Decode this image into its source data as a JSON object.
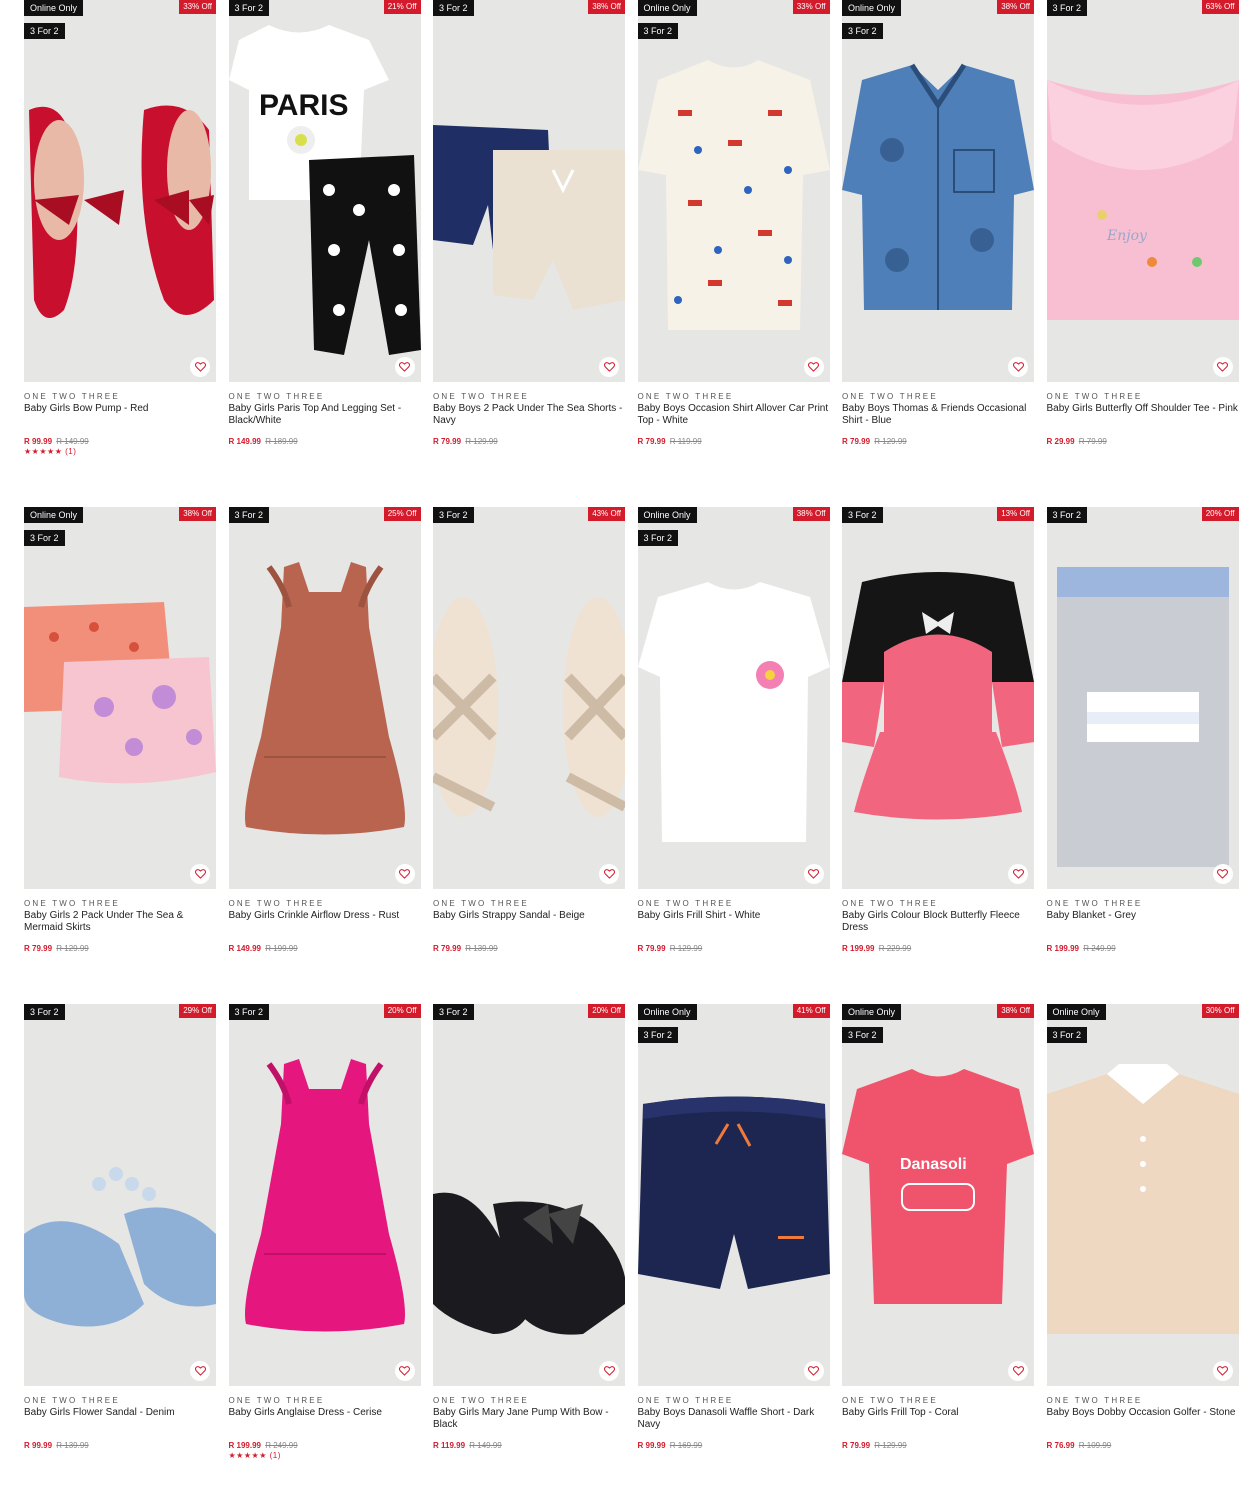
{
  "products": [
    {
      "online": "Online Only",
      "deal": "3 For 2",
      "off": "33% Off",
      "brand": "ONE TWO THREE",
      "title": "Baby Girls Bow Pump - Red",
      "price": "R 99.99",
      "was": "R 149.99",
      "stars": "★★★★★",
      "reviews": "(1)",
      "art": "shoes-red",
      "colors": {
        "bg": "#e6e6e4",
        "main": "#c8102e",
        "accent": "#e8b9a6"
      }
    },
    {
      "online": "",
      "deal": "3 For 2",
      "off": "21% Off",
      "brand": "ONE TWO THREE",
      "title": "Baby Girls Paris Top And Legging Set - Black/White",
      "price": "R 149.99",
      "was": "R 189.99",
      "stars": "",
      "reviews": "",
      "art": "top-legging",
      "colors": {
        "bg": "#e6e6e4",
        "main": "#ffffff",
        "accent": "#111111"
      }
    },
    {
      "online": "",
      "deal": "3 For 2",
      "off": "38% Off",
      "brand": "ONE TWO THREE",
      "title": "Baby Boys 2 Pack Under The Sea Shorts - Navy",
      "price": "R 79.99",
      "was": "R 129.99",
      "stars": "",
      "reviews": "",
      "art": "shorts-pair",
      "colors": {
        "bg": "#e6e6e4",
        "main": "#1f2f66",
        "accent": "#eae1d2"
      }
    },
    {
      "online": "Online Only",
      "deal": "3 For 2",
      "off": "33% Off",
      "brand": "ONE TWO THREE",
      "title": "Baby Boys Occasion Shirt Allover Car Print Top - White",
      "price": "R 79.99",
      "was": "R 119.99",
      "stars": "",
      "reviews": "",
      "art": "shirt-print",
      "colors": {
        "bg": "#e6e6e4",
        "main": "#f6f2e8",
        "accent": "#d2382d"
      }
    },
    {
      "online": "Online Only",
      "deal": "3 For 2",
      "off": "38% Off",
      "brand": "ONE TWO THREE",
      "title": "Baby Boys Thomas & Friends Occasional Shirt - Blue",
      "price": "R 79.99",
      "was": "R 129.99",
      "stars": "",
      "reviews": "",
      "art": "shirt-blue",
      "colors": {
        "bg": "#e6e6e4",
        "main": "#4f7fb8",
        "accent": "#2a4d7a"
      }
    },
    {
      "online": "",
      "deal": "3 For 2",
      "off": "63% Off",
      "brand": "ONE TWO THREE",
      "title": "Baby Girls Butterfly Off Shoulder Tee - Pink",
      "price": "R 29.99",
      "was": "R 79.99",
      "stars": "",
      "reviews": "",
      "art": "tee-pink",
      "colors": {
        "bg": "#e6e6e4",
        "main": "#f8bfd2",
        "accent": "#9aa7c9"
      }
    },
    {
      "online": "Online Only",
      "deal": "3 For 2",
      "off": "38% Off",
      "brand": "ONE TWO THREE",
      "title": "Baby Girls 2 Pack Under The Sea & Mermaid Skirts",
      "price": "R 79.99",
      "was": "R 129.99",
      "stars": "",
      "reviews": "",
      "art": "skirts",
      "colors": {
        "bg": "#e6e6e4",
        "main": "#f28f7b",
        "accent": "#c28cd6"
      }
    },
    {
      "online": "",
      "deal": "3 For 2",
      "off": "25% Off",
      "brand": "ONE TWO THREE",
      "title": "Baby Girls Crinkle Airflow Dress - Rust",
      "price": "R 149.99",
      "was": "R 199.99",
      "stars": "",
      "reviews": "",
      "art": "dress",
      "colors": {
        "bg": "#e6e6e4",
        "main": "#b8644f",
        "accent": "#9e5240"
      }
    },
    {
      "online": "",
      "deal": "3 For 2",
      "off": "43% Off",
      "brand": "ONE TWO THREE",
      "title": "Baby Girls Strappy Sandal - Beige",
      "price": "R 79.99",
      "was": "R 139.99",
      "stars": "",
      "reviews": "",
      "art": "sandals",
      "colors": {
        "bg": "#e6e6e4",
        "main": "#efe2d2",
        "accent": "#cdbba6"
      }
    },
    {
      "online": "Online Only",
      "deal": "3 For 2",
      "off": "38% Off",
      "brand": "ONE TWO THREE",
      "title": "Baby Girls Frill Shirt - White",
      "price": "R 79.99",
      "was": "R 129.99",
      "stars": "",
      "reviews": "",
      "art": "tee-white",
      "colors": {
        "bg": "#e6e6e4",
        "main": "#ffffff",
        "accent": "#f47fb3"
      }
    },
    {
      "online": "",
      "deal": "3 For 2",
      "off": "13% Off",
      "brand": "ONE TWO THREE",
      "title": "Baby Girls Colour Block Butterfly Fleece Dress",
      "price": "R 199.99",
      "was": "R 229.99",
      "stars": "",
      "reviews": "",
      "art": "colourblock",
      "colors": {
        "bg": "#e6e6e4",
        "main": "#f2657e",
        "accent": "#151515"
      }
    },
    {
      "online": "",
      "deal": "3 For 2",
      "off": "20% Off",
      "brand": "ONE TWO THREE",
      "title": "Baby Blanket - Grey",
      "price": "R 199.99",
      "was": "R 249.99",
      "stars": "",
      "reviews": "",
      "art": "blanket",
      "colors": {
        "bg": "#e6e6e4",
        "main": "#c9ccd2",
        "accent": "#9db6dd"
      }
    },
    {
      "online": "",
      "deal": "3 For 2",
      "off": "29% Off",
      "brand": "ONE TWO THREE",
      "title": "Baby Girls Flower Sandal - Denim",
      "price": "R 99.99",
      "was": "R 139.99",
      "stars": "",
      "reviews": "",
      "art": "sandal-denim",
      "colors": {
        "bg": "#e6e6e4",
        "main": "#8fb0d6",
        "accent": "#c9d9ec"
      }
    },
    {
      "online": "",
      "deal": "3 For 2",
      "off": "20% Off",
      "brand": "ONE TWO THREE",
      "title": "Baby Girls Anglaise Dress - Cerise",
      "price": "R 199.99",
      "was": "R 249.99",
      "stars": "★★★★★",
      "reviews": "(1)",
      "art": "dress",
      "colors": {
        "bg": "#e6e6e4",
        "main": "#e5177f",
        "accent": "#c21068"
      }
    },
    {
      "online": "",
      "deal": "3 For 2",
      "off": "20% Off",
      "brand": "ONE TWO THREE",
      "title": "Baby Girls Mary Jane Pump With Bow - Black",
      "price": "R 119.99",
      "was": "R 149.99",
      "stars": "",
      "reviews": "",
      "art": "shoes-black",
      "colors": {
        "bg": "#e6e6e4",
        "main": "#1b1b1f",
        "accent": "#444"
      }
    },
    {
      "online": "Online Only",
      "deal": "3 For 2",
      "off": "41% Off",
      "brand": "ONE TWO THREE",
      "title": "Baby Boys Danasoli Waffle Short - Dark Navy",
      "price": "R 99.99",
      "was": "R 169.99",
      "stars": "",
      "reviews": "",
      "art": "short-navy",
      "colors": {
        "bg": "#e6e6e4",
        "main": "#1c2650",
        "accent": "#f07a3c"
      }
    },
    {
      "online": "Online Only",
      "deal": "3 For 2",
      "off": "38% Off",
      "brand": "ONE TWO THREE",
      "title": "Baby Girls Frill Top - Coral",
      "price": "R 79.99",
      "was": "R 129.99",
      "stars": "",
      "reviews": "",
      "art": "tee-coral",
      "colors": {
        "bg": "#e6e6e4",
        "main": "#f0546c",
        "accent": "#ffffff"
      }
    },
    {
      "online": "Online Only",
      "deal": "3 For 2",
      "off": "30% Off",
      "brand": "ONE TWO THREE",
      "title": "Baby Boys Dobby Occasion Golfer - Stone",
      "price": "R 76.99",
      "was": "R 109.99",
      "stars": "",
      "reviews": "",
      "art": "golfer",
      "colors": {
        "bg": "#e6e6e4",
        "main": "#eed8c2",
        "accent": "#ffffff"
      }
    }
  ]
}
